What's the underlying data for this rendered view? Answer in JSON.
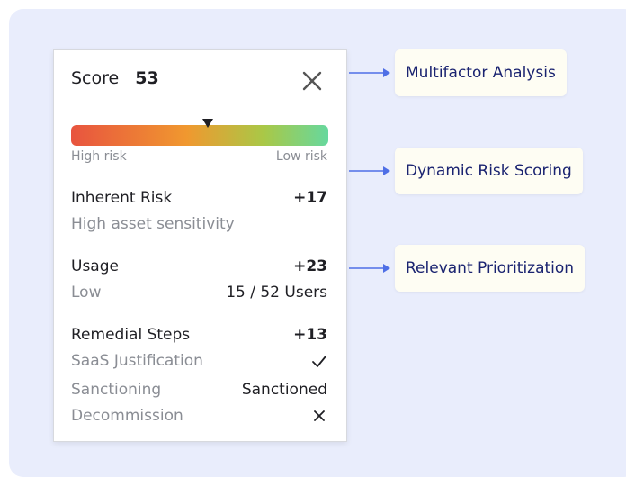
{
  "score_card": {
    "title": "Score",
    "value": "53",
    "gauge": {
      "left_label": "High risk",
      "right_label": "Low risk",
      "marker_fraction": 0.53,
      "gradient_colors": [
        "#e8543f",
        "#f0982f",
        "#a9c847",
        "#66d89e"
      ]
    },
    "inherent_risk": {
      "title": "Inherent Risk",
      "points": "+17",
      "detail": "High asset sensitivity"
    },
    "usage": {
      "title": "Usage",
      "points": "+23",
      "level": "Low",
      "users": "15 / 52 Users"
    },
    "remedial_steps": {
      "title": "Remedial Steps",
      "points": "+13",
      "items": [
        {
          "label": "SaaS Justification",
          "status_icon": "check-icon"
        },
        {
          "label": "Sanctioning",
          "value": "Sanctioned"
        },
        {
          "label": "Decommission",
          "status_icon": "x-icon"
        }
      ]
    }
  },
  "callouts": [
    {
      "label": "Multifactor Analysis"
    },
    {
      "label": "Dynamic Risk Scoring"
    },
    {
      "label": "Relevant Prioritization"
    }
  ],
  "colors": {
    "background": "#e9edfc",
    "callout_text": "#1a2370",
    "arrow": "#4f6fe6"
  }
}
